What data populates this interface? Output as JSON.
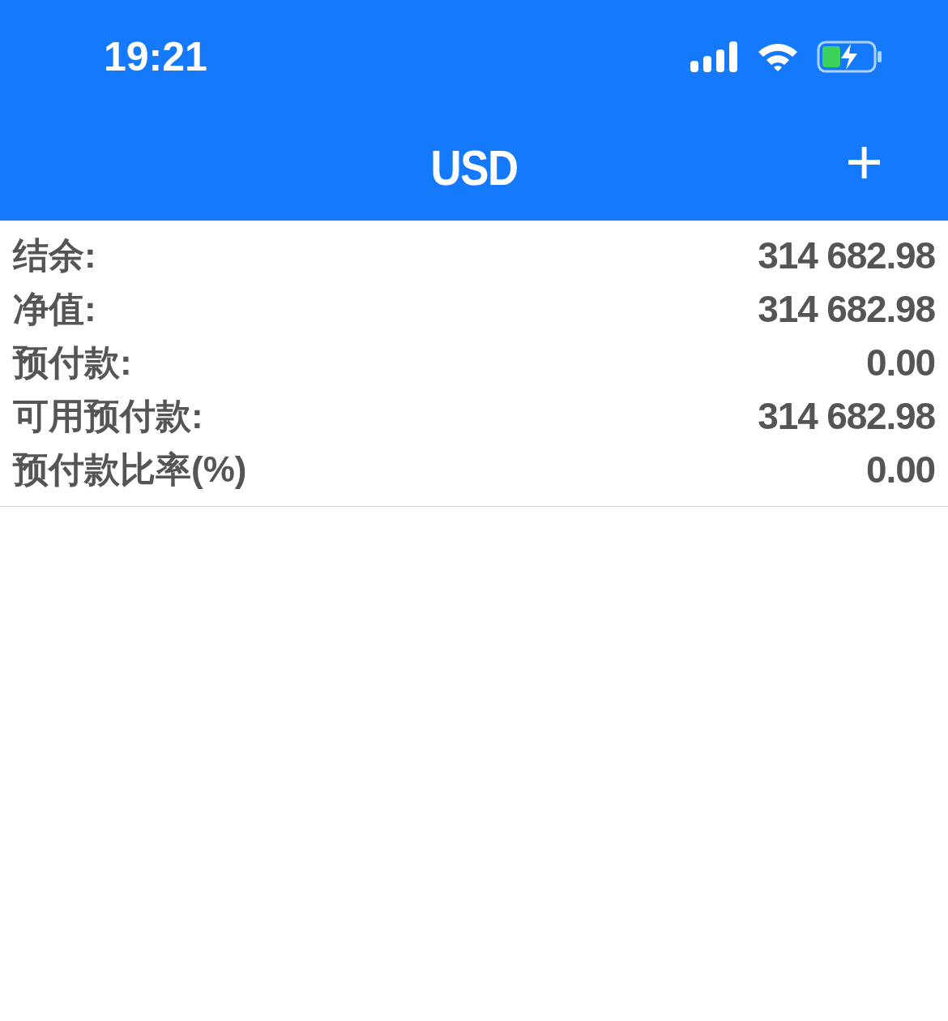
{
  "status_bar": {
    "time": "19:21"
  },
  "nav_bar": {
    "title": "USD",
    "action": "+"
  },
  "rows": [
    {
      "label": "结余:",
      "value": "314 682.98"
    },
    {
      "label": "净值:",
      "value": "314 682.98"
    },
    {
      "label": "预付款:",
      "value": "0.00"
    },
    {
      "label": "可用预付款:",
      "value": "314 682.98"
    },
    {
      "label": "预付款比率(%)",
      "value": "0.00"
    }
  ]
}
